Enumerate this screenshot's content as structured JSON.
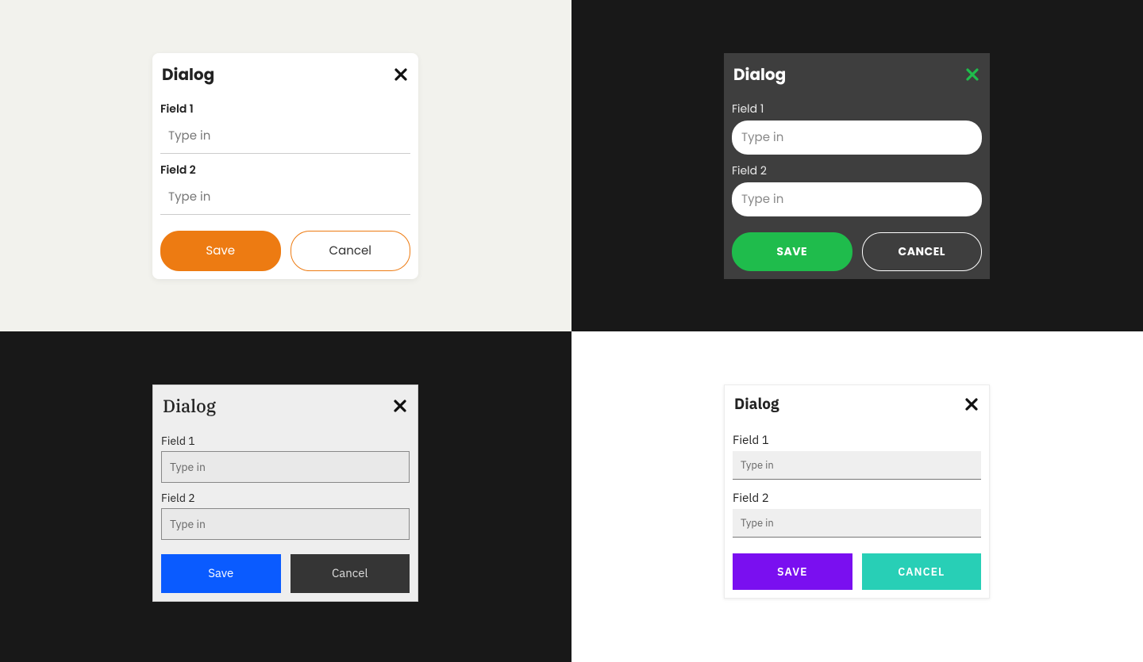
{
  "dialogs": [
    {
      "title": "Dialog",
      "field1_label": "Field 1",
      "field1_placeholder": "Type in",
      "field2_label": "Field 2",
      "field2_placeholder": "Type in",
      "save_label": "Save",
      "cancel_label": "Cancel"
    },
    {
      "title": "Dialog",
      "field1_label": "Field 1",
      "field1_placeholder": "Type in",
      "field2_label": "Field 2",
      "field2_placeholder": "Type in",
      "save_label": "SAVE",
      "cancel_label": "CANCEL"
    },
    {
      "title": "Dialog",
      "field1_label": "Field 1",
      "field1_placeholder": "Type in",
      "field2_label": "Field 2",
      "field2_placeholder": "Type in",
      "save_label": "Save",
      "cancel_label": "Cancel"
    },
    {
      "title": "Dialog",
      "field1_label": "Field 1",
      "field1_placeholder": "Type in",
      "field2_label": "Field 2",
      "field2_placeholder": "Type in",
      "save_label": "SAVE",
      "cancel_label": "CANCEL"
    }
  ]
}
